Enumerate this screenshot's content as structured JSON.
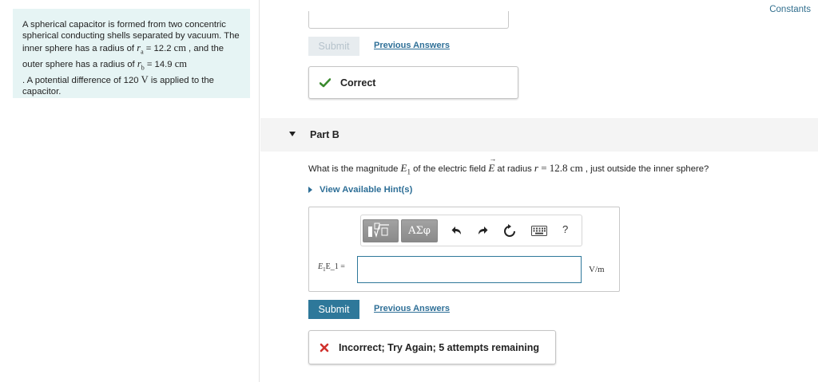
{
  "problem": {
    "intro": "A spherical capacitor is formed from two concentric spherical conducting shells separated by vacuum. The inner sphere has a radius of ",
    "ra_sym": "r",
    "ra_sub": "a",
    "ra_eq": " = 12.2 ",
    "unit_cm": "cm",
    "mid": " , and the outer sphere has a radius of ",
    "rb_sym": "r",
    "rb_sub": "b",
    "rb_eq": " = 14.9 ",
    "tail_a": " . A potential difference of 120 ",
    "volt": "V",
    "tail_b": " is applied to the capacitor."
  },
  "constants_label": "Constants",
  "part_a": {
    "submit_label": "Submit",
    "previous_answers": "Previous Answers",
    "feedback": "Correct"
  },
  "part_b": {
    "title": "Part B",
    "q_pre": "What is the magnitude ",
    "q_E": "E",
    "q_E_sub": "1",
    "q_mid1": " of the electric field ",
    "q_vecE": "E",
    "q_mid2": " at radius ",
    "q_r": "r",
    "q_eq": " = 12.8 ",
    "q_cm": "cm",
    "q_post": " , just outside the inner sphere?",
    "hint": "View Available Hint(s)",
    "toolbar": {
      "greek": "ΑΣφ",
      "help": "?",
      "icons": [
        "templates-icon",
        "undo-icon",
        "redo-icon",
        "reset-icon",
        "keyboard-icon"
      ]
    },
    "input_label_math": "E",
    "input_label_sub": "1",
    "input_label_text": "E_1 =",
    "input_value": "",
    "unit": "V/m",
    "submit_label": "Submit",
    "previous_answers": "Previous Answers",
    "feedback": "Incorrect; Try Again; 5 attempts remaining"
  },
  "colors": {
    "problem_bg": "#e6f4f4",
    "primary": "#2e789a",
    "link": "#2e6f97",
    "correct": "#3a8a2e",
    "incorrect": "#d0312d"
  }
}
